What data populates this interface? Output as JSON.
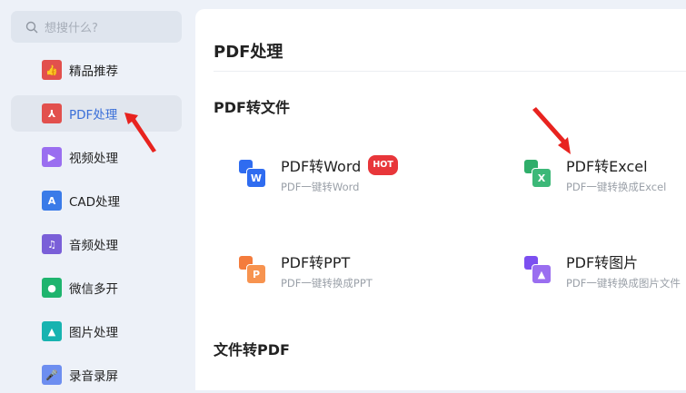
{
  "sidebar": {
    "search_placeholder": "想搜什么?",
    "items": [
      {
        "label": "精品推荐",
        "icon": "thumbs-up-icon",
        "color": "#e2504d"
      },
      {
        "label": "PDF处理",
        "icon": "pdf-icon",
        "color": "#e2504d"
      },
      {
        "label": "视频处理",
        "icon": "play-icon",
        "color": "#9a6ef0"
      },
      {
        "label": "CAD处理",
        "icon": "cad-icon",
        "color": "#3a7be8"
      },
      {
        "label": "音频处理",
        "icon": "music-icon",
        "color": "#7a5fd8"
      },
      {
        "label": "微信多开",
        "icon": "wechat-icon",
        "color": "#1fb46e"
      },
      {
        "label": "图片处理",
        "icon": "image-icon",
        "color": "#17b3b0"
      },
      {
        "label": "录音录屏",
        "icon": "mic-icon",
        "color": "#6d8ef0"
      }
    ]
  },
  "main": {
    "title": "PDF处理",
    "section1": "PDF转文件",
    "section2": "文件转PDF",
    "tools": [
      {
        "name": "PDF转Word",
        "desc": "PDF一键转Word",
        "badge": "HOT",
        "letter": "W",
        "color": "#2f6cf0"
      },
      {
        "name": "PDF转Excel",
        "desc": "PDF一键转换成Excel",
        "letter": "X",
        "color": "#2fae6a"
      },
      {
        "name": "PDF转PPT",
        "desc": "PDF一键转换成PPT",
        "letter": "P",
        "color": "#f47c3c"
      },
      {
        "name": "PDF转图片",
        "desc": "PDF一键转换成图片文件",
        "letter": "▲",
        "color": "#7c4ff0"
      }
    ]
  }
}
